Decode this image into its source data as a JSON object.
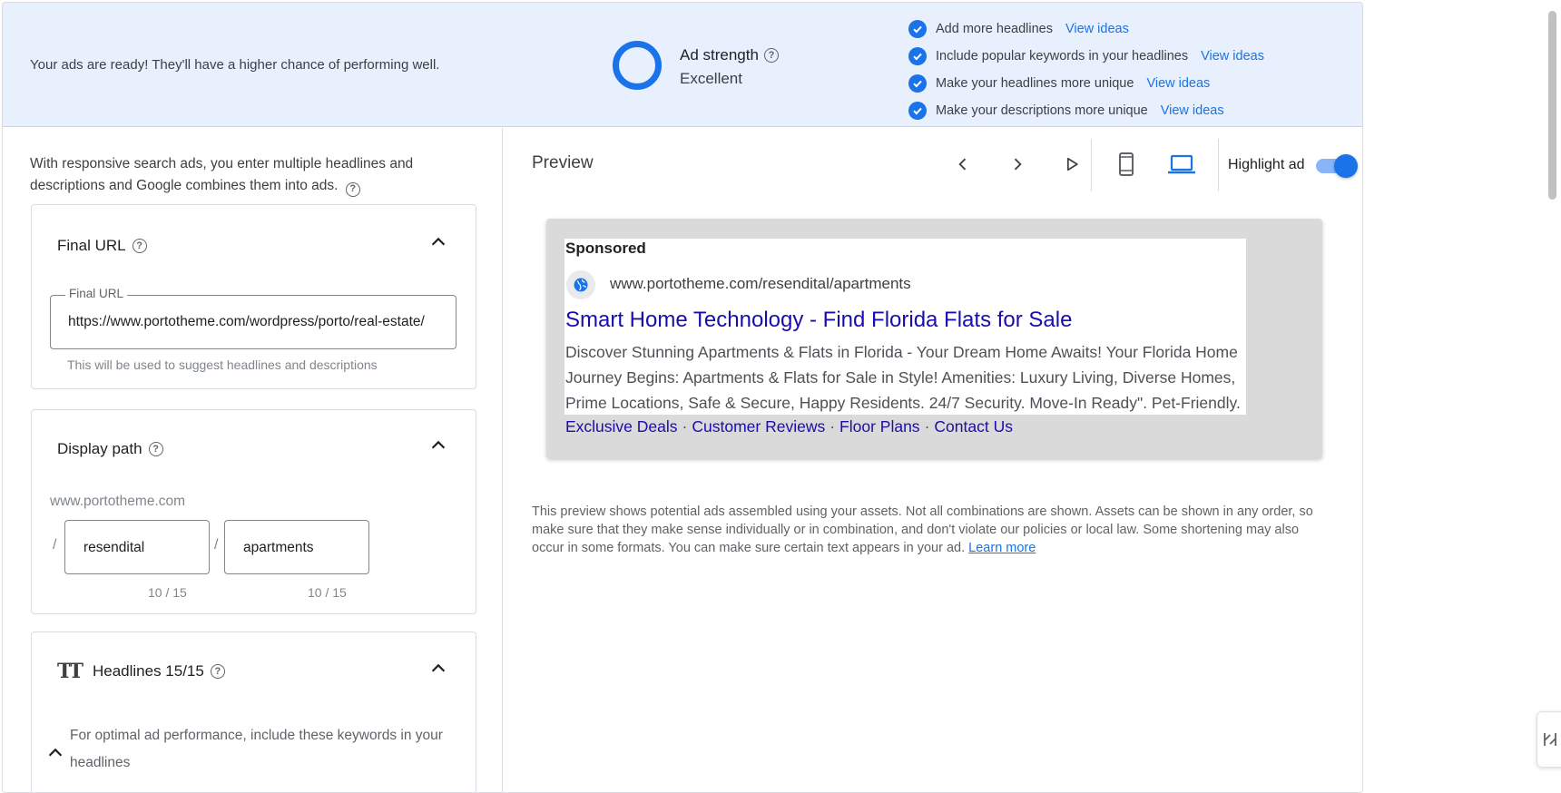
{
  "banner": {
    "message": "Your ads are ready! They'll have a higher chance of performing well.",
    "strength_title": "Ad strength",
    "strength_value": "Excellent",
    "tips": [
      {
        "text": "Add more headlines",
        "link": "View ideas"
      },
      {
        "text": "Include popular keywords in your headlines",
        "link": "View ideas"
      },
      {
        "text": "Make your headlines more unique",
        "link": "View ideas"
      },
      {
        "text": "Make your descriptions more unique",
        "link": "View ideas"
      }
    ]
  },
  "left": {
    "intro": "With responsive search ads, you enter multiple headlines and descriptions and Google combines them into ads.",
    "final_url": {
      "title": "Final URL",
      "field_label": "Final URL",
      "value": "https://www.portotheme.com/wordpress/porto/real-estate/",
      "hint": "This will be used to suggest headlines and descriptions"
    },
    "display_path": {
      "title": "Display path",
      "domain": "www.portotheme.com",
      "path1": "resendital",
      "path2": "apartments",
      "count1": "10 / 15",
      "count2": "10 / 15",
      "separator": "/"
    },
    "headlines": {
      "title": "Headlines 15/15",
      "hint": "For optimal ad performance, include these keywords in your headlines"
    }
  },
  "preview": {
    "title": "Preview",
    "highlight_label": "Highlight ad",
    "highlight_on": true,
    "ad": {
      "sponsored": "Sponsored",
      "url": "www.portotheme.com/resendital/apartments",
      "headline": "Smart Home Technology - Find Florida Flats for Sale",
      "description": "Discover Stunning Apartments & Flats in Florida - Your Dream Home Awaits! Your Florida Home Journey Begins: Apartments & Flats for Sale in Style! Amenities: Luxury Living, Diverse Homes, Prime Locations, Safe & Secure, Happy Residents. 24/7 Security. Move-In Ready\". Pet-Friendly.",
      "sitelinks": [
        "Exclusive Deals",
        "Customer Reviews",
        "Floor Plans",
        "Contact Us"
      ],
      "sitelink_separator": "·"
    },
    "disclaimer": "This preview shows potential ads assembled using your assets. Not all combinations are shown. Assets can be shown in any order, so make sure that they make sense individually or in combination, and don't violate our policies or local law. Some shortening may also occur in some formats. You can make sure certain text appears in your ad.",
    "learn_more": "Learn more"
  },
  "colors": {
    "accent": "#1a73e8",
    "banner_bg": "#e8f0fe",
    "ad_headline": "#1a0dab"
  }
}
